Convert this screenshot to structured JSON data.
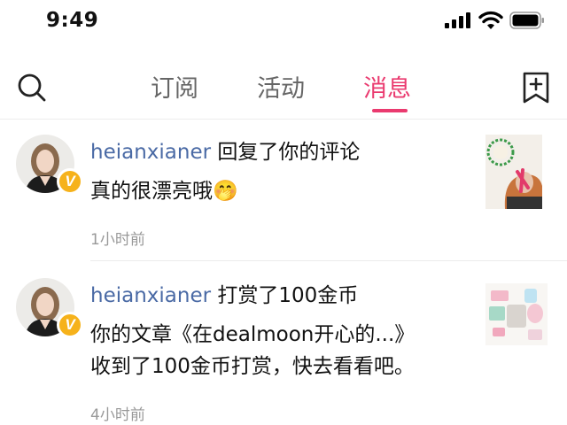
{
  "status_bar": {
    "time": "9:49"
  },
  "nav": {
    "tabs": [
      {
        "label": "订阅"
      },
      {
        "label": "活动"
      },
      {
        "label": "消息"
      }
    ],
    "active_tab": "消息",
    "accent": "#ea3a6f"
  },
  "messages": [
    {
      "username": "heianxianer",
      "action": " 回复了你的评论",
      "body_lines": [
        "真的很漂亮哦🤭"
      ],
      "time": "1小时前",
      "verified_badge": "V"
    },
    {
      "username": "heianxianer",
      "action": " 打赏了100金币",
      "body_lines": [
        "你的文章《在dealmoon开心的...》",
        "收到了100金币打赏，快去看看吧。"
      ],
      "time": "4小时前",
      "verified_badge": "V"
    }
  ],
  "icons": {
    "search": "search-icon",
    "compose": "compose-icon",
    "signal": "cellular-signal-icon",
    "wifi": "wifi-icon",
    "battery": "battery-icon"
  },
  "colors": {
    "username": "#4a6aa5",
    "timestamp": "#999999",
    "badge": "#f6b21b"
  }
}
